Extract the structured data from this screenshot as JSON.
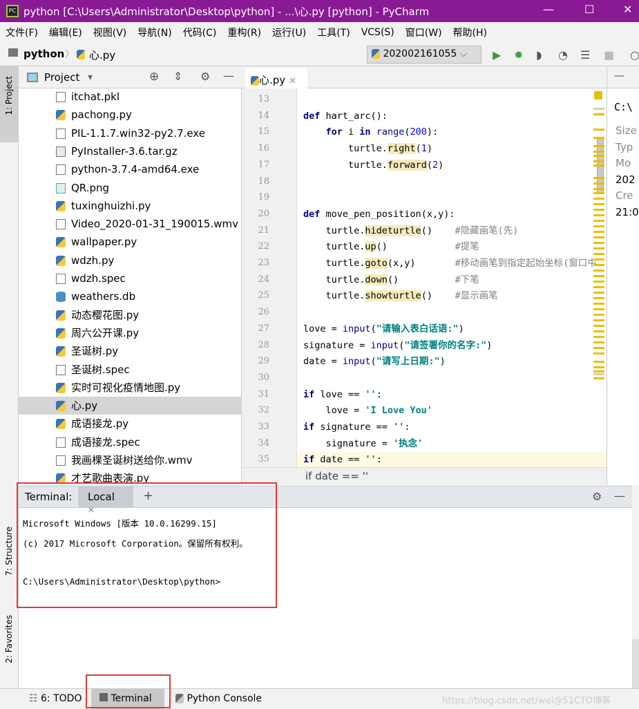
{
  "window": {
    "title": "python [C:\\Users\\Administrator\\Desktop\\python] - ...\\心.py [python] - PyCharm",
    "logo": "PC"
  },
  "menu": [
    "文件(F)",
    "编辑(E)",
    "视图(V)",
    "导航(N)",
    "代码(C)",
    "重构(R)",
    "运行(U)",
    "工具(T)",
    "VCS(S)",
    "窗口(W)",
    "帮助(H)"
  ],
  "breadcrumb": {
    "project": "python",
    "file": "心.py"
  },
  "run_config": "202002161055",
  "left_stripe": {
    "project": "1: Project",
    "structure": "7: Structure",
    "favorites": "2: Favorites"
  },
  "project_panel": {
    "title": "Project",
    "selected": "心.py",
    "files": [
      {
        "name": "itchat.pkl",
        "icon": "file"
      },
      {
        "name": "pachong.py",
        "icon": "python"
      },
      {
        "name": "PIL-1.1.7.win32-py2.7.exe",
        "icon": "file"
      },
      {
        "name": "PyInstaller-3.6.tar.gz",
        "icon": "archive"
      },
      {
        "name": "python-3.7.4-amd64.exe",
        "icon": "file"
      },
      {
        "name": "QR.png",
        "icon": "image"
      },
      {
        "name": "tuxinghuizhi.py",
        "icon": "python"
      },
      {
        "name": "Video_2020-01-31_190015.wmv",
        "icon": "file"
      },
      {
        "name": "wallpaper.py",
        "icon": "python"
      },
      {
        "name": "wdzh.py",
        "icon": "python"
      },
      {
        "name": "wdzh.spec",
        "icon": "file"
      },
      {
        "name": "weathers.db",
        "icon": "database"
      },
      {
        "name": "动态樱花图.py",
        "icon": "python"
      },
      {
        "name": "周六公开课.py",
        "icon": "python"
      },
      {
        "name": "圣诞树.py",
        "icon": "python"
      },
      {
        "name": "圣诞树.spec",
        "icon": "file"
      },
      {
        "name": "实时可视化疫情地图.py",
        "icon": "python"
      },
      {
        "name": "心.py",
        "icon": "python"
      },
      {
        "name": "成语接龙.py",
        "icon": "python"
      },
      {
        "name": "成语接龙.spec",
        "icon": "file"
      },
      {
        "name": "我画棵圣诞树送给你.wmv",
        "icon": "file"
      },
      {
        "name": "才艺歌曲表演.py",
        "icon": "python"
      }
    ]
  },
  "editor": {
    "tab": "心.py",
    "hint": "if date == ''",
    "lines": [
      {
        "n": "13",
        "t": []
      },
      {
        "n": "14",
        "t": [
          [
            "def",
            "k"
          ],
          [
            " hart_arc():",
            ""
          ]
        ]
      },
      {
        "n": "15",
        "t": [
          [
            "    ",
            ""
          ],
          [
            "for",
            "k"
          ],
          [
            " i ",
            ""
          ],
          [
            "in",
            "k"
          ],
          [
            " ",
            ""
          ],
          [
            "range",
            "b"
          ],
          [
            "(",
            ""
          ],
          [
            "200",
            "n"
          ],
          [
            "):",
            ""
          ]
        ]
      },
      {
        "n": "16",
        "t": [
          [
            "        turtle.",
            ""
          ],
          [
            "right",
            "h"
          ],
          [
            "(",
            ""
          ],
          [
            "1",
            "n"
          ],
          [
            ")",
            ""
          ]
        ]
      },
      {
        "n": "17",
        "t": [
          [
            "        turtle.",
            ""
          ],
          [
            "forward",
            "h"
          ],
          [
            "(",
            ""
          ],
          [
            "2",
            "n"
          ],
          [
            ")",
            ""
          ]
        ]
      },
      {
        "n": "18",
        "t": []
      },
      {
        "n": "19",
        "t": []
      },
      {
        "n": "20",
        "t": [
          [
            "def",
            "k"
          ],
          [
            " move_pen_position(x,y):",
            ""
          ]
        ]
      },
      {
        "n": "21",
        "t": [
          [
            "    turtle.",
            ""
          ],
          [
            "hideturtle",
            "h"
          ],
          [
            "()    ",
            ""
          ],
          [
            "#隐藏画笔(先)",
            "c"
          ]
        ]
      },
      {
        "n": "22",
        "t": [
          [
            "    turtle.",
            ""
          ],
          [
            "up",
            "h"
          ],
          [
            "()            ",
            ""
          ],
          [
            "#提笔",
            "c"
          ]
        ]
      },
      {
        "n": "23",
        "t": [
          [
            "    turtle.",
            ""
          ],
          [
            "goto",
            "h"
          ],
          [
            "(x,y)       ",
            ""
          ],
          [
            "#移动画笔到指定起始坐标(窗口中",
            "c"
          ]
        ]
      },
      {
        "n": "24",
        "t": [
          [
            "    turtle.",
            ""
          ],
          [
            "down",
            "h"
          ],
          [
            "()          ",
            ""
          ],
          [
            "#下笔",
            "c"
          ]
        ]
      },
      {
        "n": "25",
        "t": [
          [
            "    turtle.",
            ""
          ],
          [
            "showturtle",
            "h"
          ],
          [
            "()    ",
            ""
          ],
          [
            "#显示画笔",
            "c"
          ]
        ]
      },
      {
        "n": "26",
        "t": []
      },
      {
        "n": "27",
        "t": [
          [
            "love = ",
            ""
          ],
          [
            "input",
            "b"
          ],
          [
            "(",
            ""
          ],
          [
            "\"请输入表白话语:\"",
            "s"
          ],
          [
            ")",
            ""
          ]
        ]
      },
      {
        "n": "28",
        "t": [
          [
            "signature = ",
            ""
          ],
          [
            "input",
            "b"
          ],
          [
            "(",
            ""
          ],
          [
            "\"请签署你的名字:\"",
            "s"
          ],
          [
            ")",
            ""
          ]
        ]
      },
      {
        "n": "29",
        "t": [
          [
            "date = ",
            ""
          ],
          [
            "input",
            "b"
          ],
          [
            "(",
            ""
          ],
          [
            "\"请写上日期:\"",
            "s"
          ],
          [
            ")",
            ""
          ]
        ]
      },
      {
        "n": "30",
        "t": []
      },
      {
        "n": "31",
        "t": [
          [
            "if",
            "k"
          ],
          [
            " love == ",
            ""
          ],
          [
            "''",
            "s"
          ],
          [
            ":",
            ""
          ]
        ]
      },
      {
        "n": "32",
        "t": [
          [
            "    love = ",
            ""
          ],
          [
            "'I Love You'",
            "s"
          ]
        ]
      },
      {
        "n": "33",
        "t": [
          [
            "if",
            "k"
          ],
          [
            " signature == ",
            ""
          ],
          [
            "''",
            "s"
          ],
          [
            ":",
            ""
          ]
        ]
      },
      {
        "n": "34",
        "t": [
          [
            "    signature = ",
            ""
          ],
          [
            "'执念'",
            "s"
          ]
        ]
      },
      {
        "n": "35",
        "t": [
          [
            "if",
            "k"
          ],
          [
            " date == ",
            ""
          ],
          [
            "''",
            "s"
          ],
          [
            ":",
            ""
          ]
        ]
      }
    ]
  },
  "right_panel": {
    "path": "C:\\",
    "labels": [
      "Size",
      "Typ",
      "Mo",
      "202",
      "Cre",
      "21:0"
    ]
  },
  "terminal": {
    "title": "Terminal:",
    "tab": "Local",
    "lines": [
      "Microsoft Windows [版本 10.0.16299.15]",
      "(c) 2017 Microsoft Corporation。保留所有权利。",
      "",
      "C:\\Users\\Administrator\\Desktop\\python>"
    ]
  },
  "bottom_bar": {
    "todo": "6: TODO",
    "terminal": "Terminal",
    "python_console": "Python Console",
    "watermark": "https://blog.csdn.net/wei@51CTO博客"
  },
  "colors": {
    "title_bar": "#8a1a93",
    "highlight_box": "#e53935",
    "run": "#3c9a3c"
  }
}
